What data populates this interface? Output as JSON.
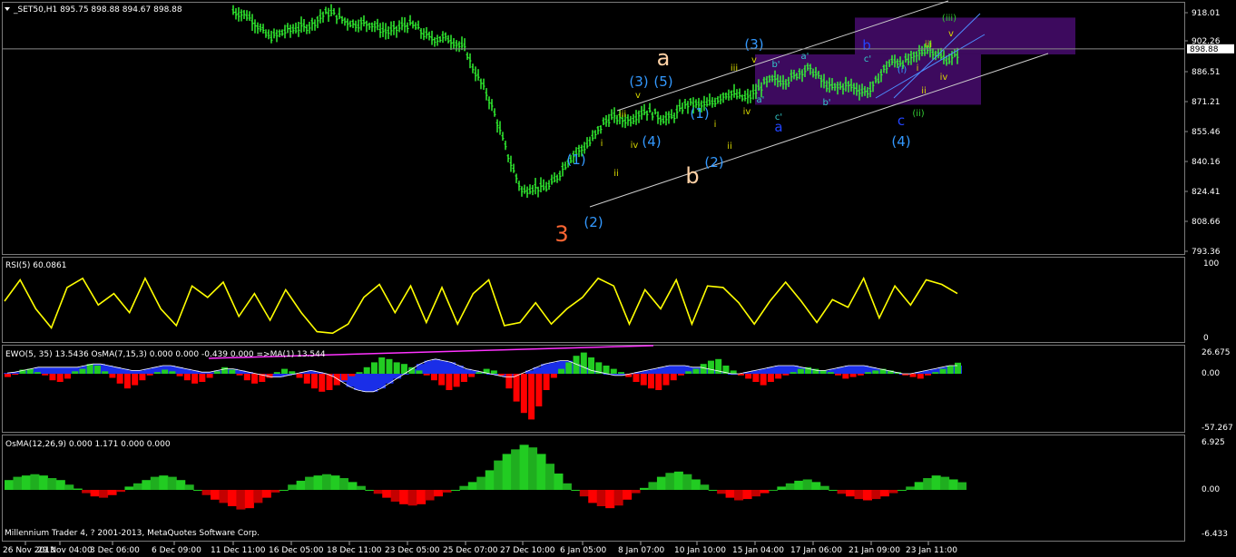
{
  "window": {
    "header": "_SET50,H1  895.75 898.88 894.67 898.88",
    "copyright": "Millennium Trader 4, ? 2001-2013, MetaQuotes Software Corp."
  },
  "colors": {
    "background": "#000000",
    "grid": "#3a3a3a",
    "price": "#33ff33",
    "rsi": "#ffff00",
    "hist_green": "#22cc22",
    "hist_red": "#ff0000",
    "blue_fill": "#1a2ee8",
    "ma_line": "#ff33ff",
    "zone": "#3d0a5e",
    "wave_blue": "#3399ff",
    "wave_orange": "#ff6633",
    "wave_peach": "#ffd2a6",
    "wave_yellow": "#d8d800",
    "wave_green": "#33cc33",
    "wave_cyan": "#33cccc",
    "wave_darkblue": "#2244ff"
  },
  "price_scale": {
    "ticks": [
      "918.01",
      "902.26",
      "886.51",
      "871.21",
      "855.46",
      "840.16",
      "824.41",
      "808.66",
      "793.36"
    ],
    "marker": "898.88"
  },
  "panes": {
    "rsi": {
      "title": "RSI(5) 60.0861",
      "ticks": [
        "100",
        "0"
      ]
    },
    "ewo": {
      "title": "EWO(5, 35) 13.5436  OsMA(7,15,3) 0.000 0.000 -0.439 0.000  =>MA(1) 13.544",
      "ticks": [
        "26.675",
        "0.00",
        "-57.267"
      ]
    },
    "osma": {
      "title": "OsMA(12,26,9) 0.000 1.171 0.000 0.000",
      "ticks": [
        "6.925",
        "0.00",
        "-6.433"
      ]
    }
  },
  "time_axis": [
    "26 Nov 2013",
    "29 Nov 04:00",
    "3 Dec 06:00",
    "6 Dec 09:00",
    "11 Dec 11:00",
    "16 Dec 05:00",
    "18 Dec 11:00",
    "23 Dec 05:00",
    "25 Dec 07:00",
    "27 Dec 10:00",
    "6 Jan 05:00",
    "8 Jan 07:00",
    "10 Jan 10:00",
    "15 Jan 04:00",
    "17 Jan 06:00",
    "21 Jan 09:00",
    "23 Jan 11:00"
  ],
  "wave_labels": [
    {
      "t": "3",
      "c": "wave_orange",
      "s": "l"
    },
    {
      "t": "(1)",
      "c": "wave_blue",
      "s": "m"
    },
    {
      "t": "(2)",
      "c": "wave_blue",
      "s": "m"
    },
    {
      "t": "i",
      "c": "wave_yellow",
      "s": "s"
    },
    {
      "t": "ii",
      "c": "wave_yellow",
      "s": "s"
    },
    {
      "t": "iii",
      "c": "wave_yellow",
      "s": "s"
    },
    {
      "t": "iv",
      "c": "wave_yellow",
      "s": "s"
    },
    {
      "t": "v",
      "c": "wave_yellow",
      "s": "s"
    },
    {
      "t": "(3)",
      "c": "wave_blue",
      "s": "m"
    },
    {
      "t": "(4)",
      "c": "wave_blue",
      "s": "m"
    },
    {
      "t": "(5)",
      "c": "wave_blue",
      "s": "m"
    },
    {
      "t": "a",
      "c": "wave_peach",
      "s": "l"
    },
    {
      "t": "b",
      "c": "wave_peach",
      "s": "l"
    },
    {
      "t": "(1)",
      "c": "wave_blue",
      "s": "m"
    },
    {
      "t": "(2)",
      "c": "wave_blue",
      "s": "m"
    },
    {
      "t": "i",
      "c": "wave_yellow",
      "s": "s"
    },
    {
      "t": "ii",
      "c": "wave_yellow",
      "s": "s"
    },
    {
      "t": "iii",
      "c": "wave_yellow",
      "s": "s"
    },
    {
      "t": "iv",
      "c": "wave_yellow",
      "s": "s"
    },
    {
      "t": "(3)",
      "c": "wave_blue",
      "s": "m"
    },
    {
      "t": "v",
      "c": "wave_yellow",
      "s": "s"
    },
    {
      "t": "a'",
      "c": "wave_cyan",
      "s": "s"
    },
    {
      "t": "b'",
      "c": "wave_cyan",
      "s": "s"
    },
    {
      "t": "c'",
      "c": "wave_cyan",
      "s": "s"
    },
    {
      "t": "a",
      "c": "wave_darkblue",
      "s": "m"
    },
    {
      "t": "a'",
      "c": "wave_cyan",
      "s": "s"
    },
    {
      "t": "b'",
      "c": "wave_cyan",
      "s": "s"
    },
    {
      "t": "b",
      "c": "wave_darkblue",
      "s": "m"
    },
    {
      "t": "c'",
      "c": "wave_cyan",
      "s": "s"
    },
    {
      "t": "c",
      "c": "wave_darkblue",
      "s": "m"
    },
    {
      "t": "(4)",
      "c": "wave_blue",
      "s": "m"
    },
    {
      "t": "(i)",
      "c": "wave_blue",
      "s": "s"
    },
    {
      "t": "(ii)",
      "c": "wave_green",
      "s": "s"
    },
    {
      "t": "i",
      "c": "wave_yellow",
      "s": "s"
    },
    {
      "t": "ii",
      "c": "wave_yellow",
      "s": "s"
    },
    {
      "t": "iii",
      "c": "wave_yellow",
      "s": "s"
    },
    {
      "t": "iv",
      "c": "wave_yellow",
      "s": "s"
    },
    {
      "t": "v",
      "c": "wave_yellow",
      "s": "s"
    },
    {
      "t": "(iii)",
      "c": "wave_green",
      "s": "s"
    }
  ],
  "chart_data": {
    "type": "bar",
    "instrument": "_SET50",
    "timeframe": "H1",
    "last_bar": {
      "open": 895.75,
      "high": 898.88,
      "low": 894.67,
      "close": 898.88
    },
    "ylim": [
      793.36,
      918.01
    ],
    "x": [
      "26 Nov 2013",
      "29 Nov 04:00",
      "3 Dec 06:00",
      "6 Dec 09:00",
      "11 Dec 11:00",
      "16 Dec 05:00",
      "18 Dec 11:00",
      "23 Dec 05:00",
      "25 Dec 07:00",
      "27 Dec 10:00",
      "6 Jan 05:00",
      "8 Jan 07:00",
      "10 Jan 10:00",
      "15 Jan 04:00",
      "17 Jan 06:00",
      "21 Jan 09:00",
      "23 Jan 11:00"
    ],
    "price_path": [
      {
        "x": "11 Dec 11:00",
        "y": 918.0
      },
      {
        "x": "16 Dec 05:00",
        "y": 906.5
      },
      {
        "x": "18 Dec 11:00",
        "y": 917.0
      },
      {
        "x": "23 Dec 05:00",
        "y": 906.0
      },
      {
        "x": "25 Dec 07:00",
        "y": 904.0
      },
      {
        "x": "27 Dec 10:00",
        "y": 821.0
      },
      {
        "x": "6 Jan 05:00",
        "y": 848.5
      },
      {
        "x": "8 Jan 07:00",
        "y": 868.0
      },
      {
        "x": "10 Jan 10:00",
        "y": 866.0
      },
      {
        "x": "15 Jan 04:00",
        "y": 881.0
      },
      {
        "x": "17 Jan 06:00",
        "y": 883.5
      },
      {
        "x": "21 Jan 09:00",
        "y": 880.0
      },
      {
        "x": "23 Jan 11:00",
        "y": 898.88
      }
    ],
    "rsi": {
      "name": "RSI(5)",
      "last": 60.0861,
      "ylim": [
        0,
        100
      ],
      "values": [
        50,
        78,
        40,
        15,
        68,
        80,
        45,
        60,
        35,
        80,
        40,
        18,
        70,
        55,
        75,
        30,
        60,
        25,
        65,
        35,
        10,
        8,
        20,
        55,
        72,
        35,
        70,
        22,
        68,
        20,
        60,
        78,
        18,
        22,
        48,
        20,
        40,
        55,
        80,
        70,
        20,
        65,
        40,
        78,
        20,
        70,
        68,
        48,
        20,
        50,
        75,
        50,
        22,
        52,
        42,
        80,
        28,
        70,
        45,
        78,
        72,
        60
      ]
    },
    "ewo": {
      "name": "EWO(5, 35)",
      "last": 13.5436,
      "ylim": [
        -57.267,
        26.675
      ],
      "values": [
        -4,
        -1,
        5,
        6,
        2,
        -2,
        -8,
        -10,
        -6,
        3,
        6,
        12,
        10,
        3,
        -5,
        -12,
        -18,
        -14,
        -8,
        -2,
        2,
        5,
        3,
        -3,
        -8,
        -12,
        -10,
        -5,
        3,
        8,
        5,
        -2,
        -8,
        -12,
        -10,
        -5,
        2,
        6,
        3,
        -5,
        -12,
        -18,
        -22,
        -20,
        -14,
        -8,
        -3,
        2,
        8,
        14,
        20,
        18,
        14,
        12,
        8,
        4,
        -2,
        -8,
        -14,
        -20,
        -16,
        -10,
        -4,
        2,
        6,
        4,
        -2,
        -18,
        -34,
        -48,
        -56,
        -40,
        -20,
        -5,
        6,
        14,
        22,
        26,
        20,
        14,
        10,
        6,
        2,
        -4,
        -10,
        -14,
        -18,
        -20,
        -14,
        -8,
        -2,
        3,
        6,
        12,
        16,
        18,
        10,
        4,
        -2,
        -6,
        -10,
        -14,
        -10,
        -6,
        -2,
        2,
        6,
        8,
        6,
        4,
        2,
        -2,
        -6,
        -4,
        -2,
        2,
        4,
        6,
        4,
        2,
        -2,
        -4,
        -6,
        -2,
        2,
        6,
        10,
        13.54
      ],
      "osma_values": [
        1,
        2,
        4,
        6,
        8,
        8,
        8,
        8,
        8,
        8,
        10,
        12,
        12,
        10,
        8,
        6,
        4,
        4,
        6,
        8,
        10,
        10,
        8,
        6,
        4,
        2,
        2,
        4,
        6,
        6,
        4,
        2,
        0,
        -2,
        -4,
        -4,
        -2,
        0,
        2,
        4,
        2,
        0,
        -4,
        -10,
        -16,
        -20,
        -22,
        -22,
        -18,
        -12,
        -6,
        0,
        6,
        12,
        16,
        18,
        16,
        14,
        10,
        6,
        4,
        2,
        0,
        -2,
        -4,
        -4,
        0,
        4,
        8,
        12,
        14,
        16,
        16,
        12,
        8,
        4,
        2,
        0,
        -2,
        -2,
        0,
        2,
        4,
        6,
        8,
        10,
        10,
        10,
        8,
        8,
        6,
        4,
        2,
        0,
        0,
        2,
        4,
        6,
        8,
        10,
        10,
        10,
        8,
        6,
        4,
        4,
        6,
        8,
        10,
        10,
        10,
        8,
        6,
        4,
        2,
        0,
        0,
        2,
        4,
        6,
        8,
        10,
        10
      ],
      "ma": {
        "name": "MA(1)",
        "last": 13.544
      }
    },
    "osma": {
      "name": "OsMA(12,26,9)",
      "last": 1.171,
      "ylim": [
        -6.433,
        6.925
      ],
      "values": [
        1.5,
        2,
        2.2,
        2.4,
        2.2,
        1.8,
        1.5,
        0.8,
        0.2,
        -0.5,
        -1,
        -1.2,
        -0.8,
        -0.3,
        0.5,
        1,
        1.5,
        2,
        2.2,
        2,
        1.5,
        0.8,
        0,
        -0.8,
        -1.5,
        -2,
        -2.5,
        -3,
        -2.8,
        -2,
        -1.2,
        -0.4,
        0,
        0.8,
        1.4,
        2,
        2.2,
        2.4,
        2.2,
        1.8,
        1.2,
        0.6,
        0,
        -0.6,
        -1.2,
        -1.8,
        -2.2,
        -2.4,
        -2.2,
        -1.6,
        -1,
        -0.4,
        0,
        0.6,
        1.2,
        2,
        3,
        4.5,
        5.5,
        6.2,
        6.9,
        6.5,
        5.5,
        4,
        2.5,
        1,
        0,
        -1,
        -2,
        -2.5,
        -2.8,
        -2.4,
        -1.5,
        -0.5,
        0.3,
        1.2,
        2,
        2.6,
        2.8,
        2.4,
        1.6,
        0.8,
        0,
        -0.6,
        -1.2,
        -1.6,
        -1.4,
        -1,
        -0.5,
        0,
        0.5,
        1,
        1.4,
        1.6,
        1.2,
        0.6,
        0,
        -0.6,
        -1,
        -1.4,
        -1.6,
        -1.4,
        -1,
        -0.5,
        0,
        0.5,
        1.2,
        1.8,
        2.2,
        2,
        1.6,
        1.171
      ],
      "red_values_extra": [
        -1,
        -1.5,
        -3,
        -4.5,
        -6.2,
        -5
      ]
    },
    "channels": [
      {
        "from": {
          "x": "6 Jan 05:00",
          "y": 820.5
        },
        "to": {
          "x": "23 Jan 11:00",
          "y": 897.0
        }
      },
      {
        "from": {
          "x": "6 Jan 05:00",
          "y": 865.0
        },
        "to": {
          "x": "23 Jan 11:00",
          "y": 926.0
        }
      },
      {
        "from": {
          "x": "21 Jan 09:00",
          "y": 879.0
        },
        "to": {
          "x": "23 Jan 11:00",
          "y": 915.0
        }
      },
      {
        "from": {
          "x": "21 Jan 09:00",
          "y": 870.0
        },
        "to": {
          "x": "23 Jan 11:00",
          "y": 907.0
        }
      }
    ],
    "zones": [
      {
        "x0": "21 Jan 09:00",
        "x1": "23 Jan 11:00",
        "y0": 896.0,
        "y1": 915.0
      },
      {
        "x0": "15 Jan 04:00",
        "x1": "23 Jan 11:00",
        "y0": 870.0,
        "y1": 896.0
      }
    ],
    "grid": false,
    "legend": "none"
  }
}
